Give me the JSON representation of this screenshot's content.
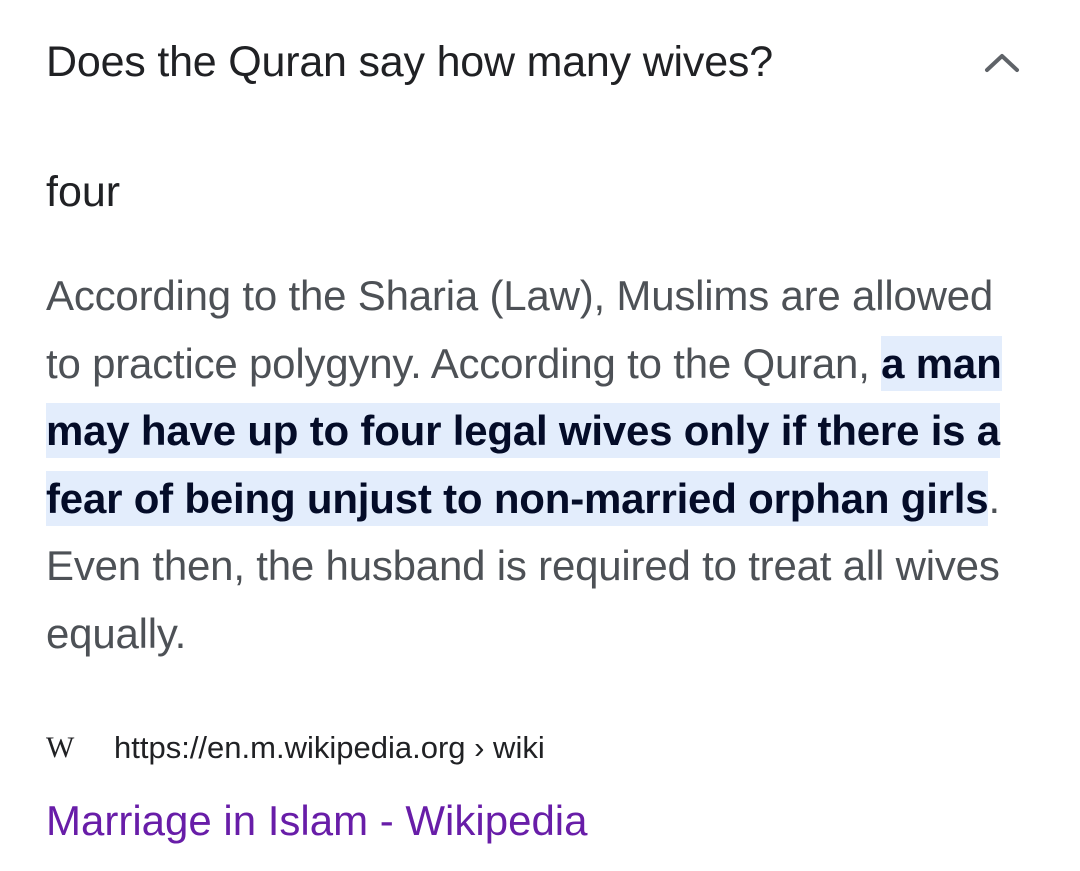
{
  "faq": {
    "question": "Does the Quran say how many wives?",
    "expanded": true,
    "toggle_icon": "chevron-up-icon",
    "short_answer": "four"
  },
  "snippet": {
    "before": "According to the Sharia (Law), Muslims are allowed to practice polygyny. According to the Quran, ",
    "highlight": "a man may have up to four legal wives only if there is a fear of being unjust to non-married orphan girls",
    "after": ". Even then, the husband is required to treat all wives equally.",
    "highlight_bg": "#e3edfc"
  },
  "source": {
    "logo_icon": "wikipedia-w-icon",
    "logo_text": "W",
    "url": "https://en.m.wikipedia.org › wiki"
  },
  "result": {
    "title": "Marriage in Islam - Wikipedia",
    "link_color": "#681da8"
  }
}
